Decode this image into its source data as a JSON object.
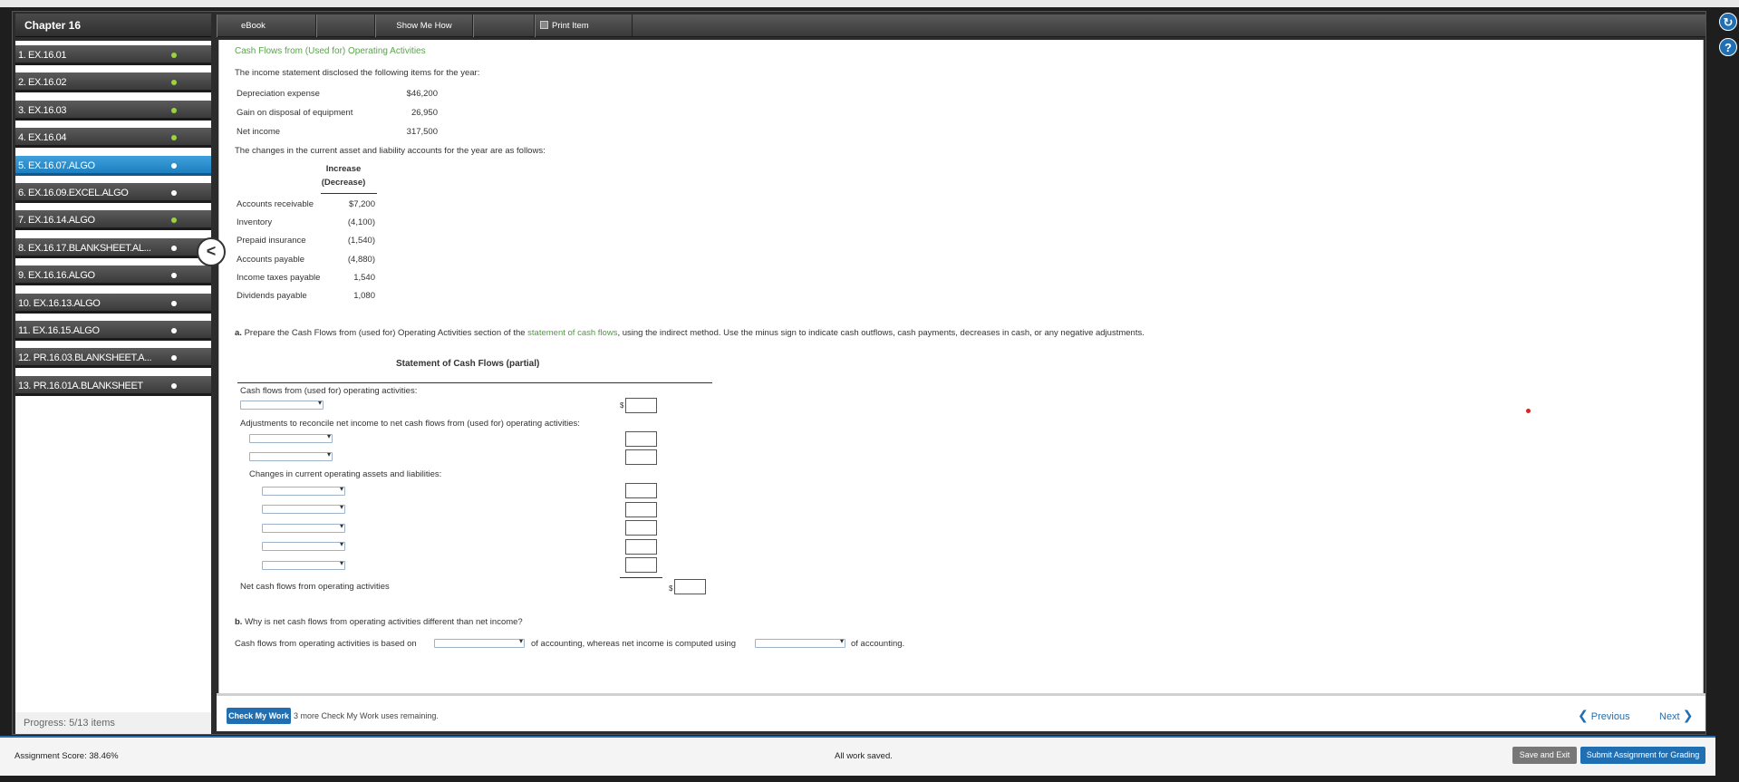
{
  "chapter_title": "Chapter 16",
  "sidebar": {
    "items": [
      {
        "label": "1. EX.16.01",
        "status": "done"
      },
      {
        "label": "2. EX.16.02",
        "status": "done"
      },
      {
        "label": "3. EX.16.03",
        "status": "done"
      },
      {
        "label": "4. EX.16.04",
        "status": "done"
      },
      {
        "label": "5. EX.16.07.ALGO",
        "status": "active"
      },
      {
        "label": "6. EX.16.09.EXCEL.ALGO",
        "status": "todo"
      },
      {
        "label": "7. EX.16.14.ALGO",
        "status": "done"
      },
      {
        "label": "8. EX.16.17.BLANKSHEET.AL...",
        "status": "todo"
      },
      {
        "label": "9. EX.16.16.ALGO",
        "status": "todo"
      },
      {
        "label": "10. EX.16.13.ALGO",
        "status": "todo"
      },
      {
        "label": "11. EX.16.15.ALGO",
        "status": "todo"
      },
      {
        "label": "12. PR.16.03.BLANKSHEET.A...",
        "status": "todo"
      },
      {
        "label": "13. PR.16.01A.BLANKSHEET",
        "status": "todo"
      }
    ],
    "progress": "Progress:  5/13 items"
  },
  "toolbar": {
    "ebook": "eBook",
    "show_me_how": "Show Me How",
    "print_item": "Print Item"
  },
  "content": {
    "title": "Cash Flows from (Used for) Operating Activities",
    "intro": "The income statement disclosed the following items for the year:",
    "income_items": [
      {
        "label": "Depreciation expense",
        "value": "$46,200"
      },
      {
        "label": "Gain on disposal of equipment",
        "value": "26,950"
      },
      {
        "label": "Net income",
        "value": "317,500"
      }
    ],
    "changes_intro": "The changes in the current asset and liability accounts for the year are as follows:",
    "change_header_1": "Increase",
    "change_header_2": "(Decrease)",
    "changes": [
      {
        "label": "Accounts receivable",
        "value": "$7,200"
      },
      {
        "label": "Inventory",
        "value": "(4,100)"
      },
      {
        "label": "Prepaid insurance",
        "value": "(1,540)"
      },
      {
        "label": "Accounts payable",
        "value": "(4,880)"
      },
      {
        "label": "Income taxes payable",
        "value": "1,540"
      },
      {
        "label": "Dividends payable",
        "value": "1,080"
      }
    ],
    "part_a_prefix": "a.",
    "part_a_text_1": " Prepare the Cash Flows from (used for) Operating Activities section of the ",
    "part_a_link": "statement of cash flows",
    "part_a_text_2": ", using the indirect method. Use the minus sign to indicate cash outflows, cash payments, decreases in cash, or any negative adjustments.",
    "statement_title": "Statement of Cash Flows (partial)",
    "cf_header": "Cash flows from (used for) operating activities:",
    "dollar_sign": "$",
    "adjustments_label": "Adjustments to reconcile net income to net cash flows from (used for) operating activities:",
    "changes_label": "Changes in current operating assets and liabilities:",
    "net_cash_label": "Net cash flows from operating activities",
    "part_b_prefix": "b.",
    "part_b_question": " Why is net cash flows from operating activities different than net income?",
    "part_b_s1": "Cash flows from operating activities is based on",
    "part_b_s2": "of accounting, whereas net income is computed using",
    "part_b_s3": "of accounting."
  },
  "footer": {
    "check_my_work": "Check My Work",
    "remaining": "3 more Check My Work uses remaining.",
    "previous": "Previous",
    "next": "Next"
  },
  "statusbar": {
    "assignment_score": "Assignment Score:  38.46%",
    "all_saved": "All work saved.",
    "save_exit": "Save and Exit",
    "submit": "Submit Assignment for Grading"
  },
  "icons": {
    "collapse": "chevron-left-icon",
    "help": "help-icon",
    "refresh": "refresh-icon"
  },
  "colors": {
    "accent": "#1f6fb2",
    "title_green": "#5ca24e",
    "done_dot": "#9bd33b"
  }
}
